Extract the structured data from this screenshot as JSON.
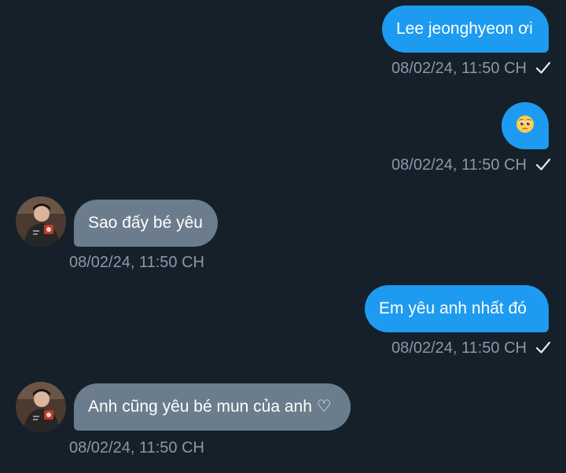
{
  "messages": [
    {
      "direction": "out",
      "text": "Lee jeonghyeon ơi",
      "time": "08/02/24, 11:50 CH",
      "status": "check-icon"
    },
    {
      "direction": "out",
      "text": "",
      "emoji": "pleading-face-icon",
      "time": "08/02/24, 11:50 CH",
      "status": "check-icon"
    },
    {
      "direction": "in",
      "text": "Sao đấy bé yêu",
      "time": "08/02/24, 11:50 CH"
    },
    {
      "direction": "out",
      "text": "Em yêu anh nhất đó",
      "time": "08/02/24, 11:50 CH",
      "status": "check-icon"
    },
    {
      "direction": "in",
      "text": "Anh cũng yêu bé mun của anh ♡",
      "time": "08/02/24, 11:50 CH"
    }
  ],
  "colors": {
    "background": "#15202b",
    "outgoing_bubble": "#1d9bf0",
    "incoming_bubble": "#6b7d8c",
    "timestamp": "#8b98a5",
    "text": "#ffffff"
  }
}
